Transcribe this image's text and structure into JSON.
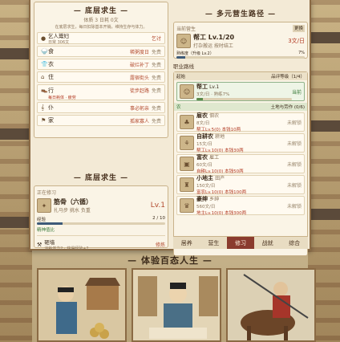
{
  "left_panel": {
    "title": "— 底层求生 —",
    "stats": "体质 3  日耗 0文",
    "desc": "在底层求生，每日扣除基本开销，维持生存与体力。",
    "beggar": {
      "name": "乞人鬻妇",
      "sub": "日常 306文",
      "action": "乞讨"
    },
    "needs": [
      {
        "icon": "食",
        "label": "食",
        "status": "稀粥度日",
        "cost": "免费"
      },
      {
        "icon": "衣",
        "label": "衣",
        "status": "破烂补丁",
        "cost": "免费"
      },
      {
        "icon": "住",
        "label": "住",
        "status": "露宿街头",
        "cost": "免费"
      },
      {
        "icon": "行",
        "label": "行",
        "status": "徒步赶路",
        "cost": "免费",
        "extra": "每日耗体 · 疲劳"
      },
      {
        "icon": "仆",
        "label": "仆",
        "status": "事必躬亲",
        "cost": "免费"
      },
      {
        "icon": "家",
        "label": "家",
        "status": "孤家寡人",
        "cost": "免费"
      }
    ],
    "train_title": "— 底层求生 —",
    "training": {
      "header": "正在修习",
      "name": "筋骨（六循）",
      "meta": "扎马步  挑水  负重",
      "level": "Lv.1",
      "progress_label": "经验",
      "progress_value": "2 / 10",
      "progress": 0.2,
      "tip": "精神值比",
      "sub_name": "砸墙",
      "sub_meta": "消耗体力2 · 获得经验+2",
      "sub_action": "修炼"
    }
  },
  "right_panel": {
    "title": "— 多元营生路径 —",
    "current_label": "当前营生",
    "current_badge": "更换",
    "current": {
      "name": "帮工 Lv.1/20",
      "meta": "打杂搬运  按时结工",
      "pay": "3文/日",
      "progress_label": "熟练度（升级 Lv.2）",
      "progress_value": "7%",
      "progress": 0.07
    },
    "career_label": "职业路线",
    "route_start": "起始",
    "route_right": "品评等级（1/4）",
    "start_job": {
      "name": "帮工",
      "lv": "Lv.1",
      "meta": "3文/日 · 熟练7%",
      "action": "当前",
      "progress": 0.07
    },
    "branch": "农",
    "branch_right": "土地与劳作 (0/6)",
    "jobs": [
      {
        "name": "雇农",
        "tag": "佃农",
        "price": "8文/日",
        "req": "帮工Lv.5(0) 本钱10两",
        "right": "未解锁"
      },
      {
        "name": "自耕农",
        "tag": "耕地",
        "price": "15文/日",
        "req": "帮工Lv.10(0) 本钱30两",
        "right": "未解锁"
      },
      {
        "name": "富农",
        "tag": "雇工",
        "price": "60文/日",
        "req": "自耕Lv.10(0) 本钱50两",
        "right": "未解锁"
      },
      {
        "name": "小地主",
        "tag": "田产",
        "price": "150文/日",
        "req": "富农Lv.10(0) 本钱100两",
        "right": "未解锁"
      },
      {
        "name": "豪绅",
        "tag": "乡绅",
        "price": "560文/日",
        "req": "地主Lv.10(0) 本钱300两",
        "right": "未解锁"
      }
    ],
    "tabs": [
      "居养",
      "营生",
      "修习",
      "战就",
      "综合"
    ],
    "active_tab": 2
  },
  "bottom": {
    "title": "— 体验百态人生 —"
  }
}
